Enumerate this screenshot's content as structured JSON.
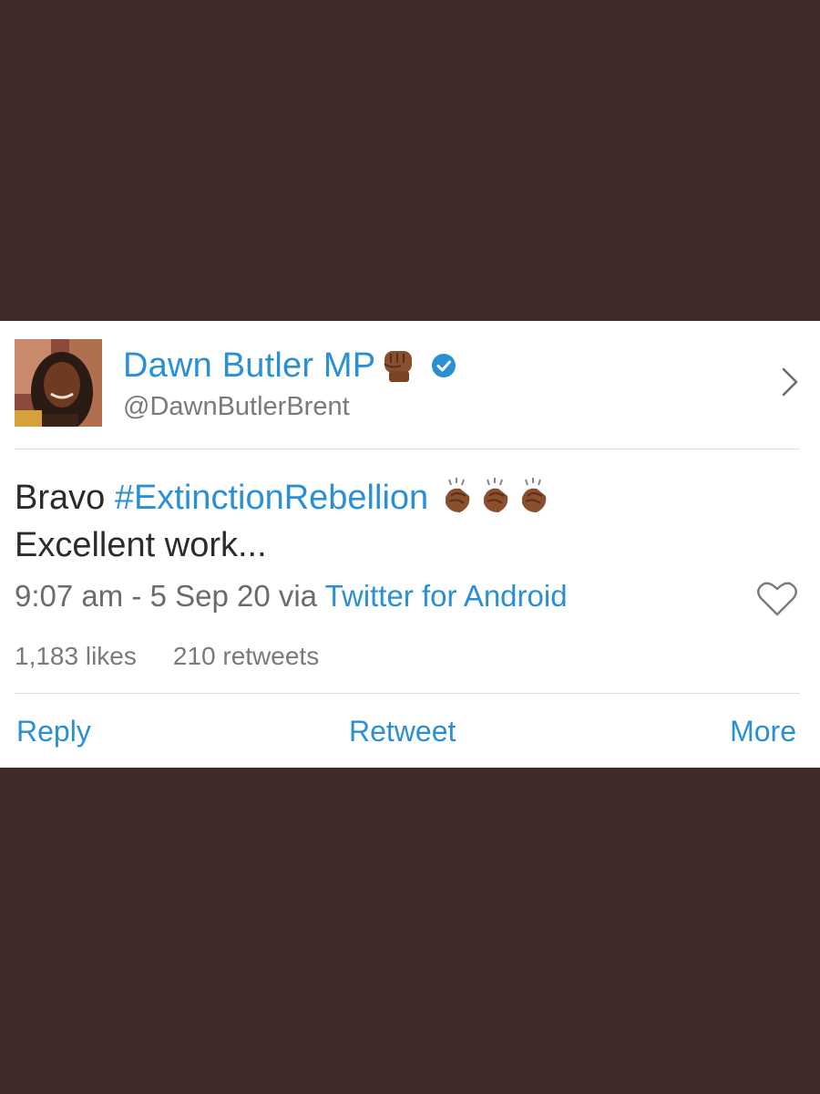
{
  "user": {
    "display_name": "Dawn Butler MP",
    "name_emoji": "raised-fist-medium-dark-skin",
    "verified": true,
    "handle": "@DawnButlerBrent"
  },
  "tweet": {
    "text_prefix": "Bravo ",
    "hashtag": "#ExtinctionRebellion",
    "trailing_emoji": [
      "clapping-hands",
      "clapping-hands",
      "clapping-hands"
    ],
    "text_line2": "Excellent work..."
  },
  "meta": {
    "time_date": "9:07 am - 5 Sep 20 via ",
    "source_app": "Twitter for Android"
  },
  "stats": {
    "likes": "1,183 likes",
    "retweets": "210 retweets"
  },
  "actions": {
    "reply": "Reply",
    "retweet": "Retweet",
    "more": "More"
  },
  "colors": {
    "background": "#3f2a29",
    "card": "#ffffff",
    "link_blue": "#2b8fd6",
    "text_dark": "#2b2b2b",
    "text_gray": "#7a7a7a"
  }
}
